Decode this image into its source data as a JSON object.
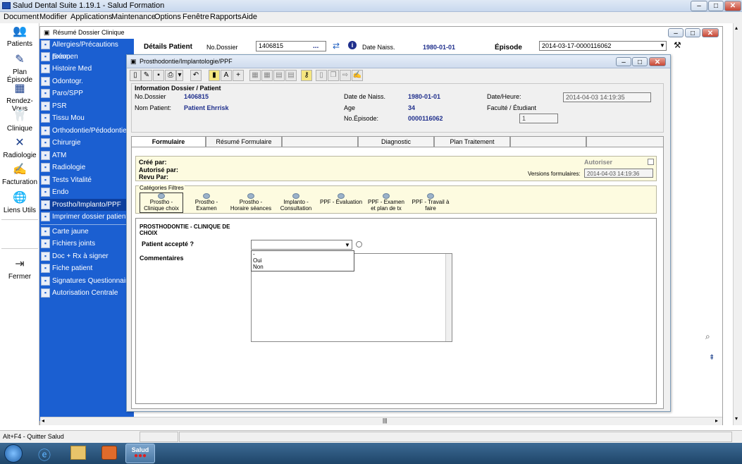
{
  "app": {
    "title": "Salud Dental Suite 1.19.1 - Salud Formation",
    "menu": [
      "Document",
      "Modifier",
      "Applications",
      "Maintenance",
      "Options",
      "Fenêtre",
      "Rapports",
      "Aide"
    ]
  },
  "leftbar": [
    {
      "label": "Patients",
      "icon": "patients-icon"
    },
    {
      "label": "Plan Épisode",
      "icon": "plan-icon"
    },
    {
      "label": "Rendez-Vous",
      "icon": "calendar-icon"
    },
    {
      "label": "Clinique",
      "icon": "tooth-icon"
    },
    {
      "label": "Radiologie",
      "icon": "xray-icon"
    },
    {
      "label": "Facturation",
      "icon": "billing-icon"
    },
    {
      "label": "Liens Utils",
      "icon": "globe-icon"
    },
    {
      "label": "Fermer",
      "icon": "exit-icon"
    }
  ],
  "outer": {
    "title": "Résumé Dossier Clinique"
  },
  "nav": [
    "Allergies/Précautions préop.",
    "Examen",
    "Histoire Med",
    "Odontogr.",
    "Paro/SPP",
    "PSR",
    "Tissu Mou",
    "Orthodontie/Pédodontie",
    "Chirurgie",
    "ATM",
    "Radiologie",
    "Tests Vitalité",
    "Endo",
    "Prostho/Implanto/PPF",
    "Imprimer dossier patient",
    "Carte jaune",
    "Fichiers joints",
    "Doc + Rx à signer",
    "Fiche patient",
    "Signatures Questionnaire",
    "Autorisation Centrale"
  ],
  "details": {
    "label": "Détails Patient",
    "no_dossier_label": "No.Dossier",
    "no_dossier": "1406815",
    "dots": "...",
    "date_naiss_label": "Date Naiss.",
    "date_naiss": "1980-01-01",
    "episode_label": "Épisode",
    "episode": "2014-03-17-0000116062"
  },
  "inner": {
    "title": "Prosthodontie/Implantologie/PPF"
  },
  "info": {
    "heading": "Information Dossier / Patient",
    "no_dossier_label": "No.Dossier",
    "no_dossier": "1406815",
    "nom_label": "Nom Patient:",
    "nom": "Patient Ehrrisk",
    "date_naiss_label": "Date de Naiss.",
    "date_naiss": "1980-01-01",
    "age_label": "Age",
    "age": "34",
    "episode_label": "No.Épisode:",
    "episode": "0000116062",
    "datetime_label": "Date/Heure:",
    "datetime": "2014-04-03 14:19:35",
    "faculte_label": "Faculté / Étudiant",
    "faculte_value": "1"
  },
  "tabs": [
    "Formulaire",
    "Résumé Formulaire",
    "",
    "Diagnostic",
    "Plan Traitement",
    "",
    ""
  ],
  "yellow": {
    "cree": "Créé par:",
    "autorise": "Autorisé par:",
    "revu": "Revu Par:",
    "autoriser": "Autoriser",
    "versions_label": "Versions formulaires:",
    "versions_value": "2014-04-03 14:19:36"
  },
  "categories": {
    "label": "Catégories Filtres",
    "items": [
      {
        "l1": "Prostho -",
        "l2": "Clinique choix"
      },
      {
        "l1": "Prostho -",
        "l2": "Examen"
      },
      {
        "l1": "Prostho -",
        "l2": "Horaire séances"
      },
      {
        "l1": "Implanto -",
        "l2": "Consultation"
      },
      {
        "l1": "PPF - Évaluation",
        "l2": ""
      },
      {
        "l1": "PPF - Examen",
        "l2": "et plan de tx"
      },
      {
        "l1": "PPF - Travail à",
        "l2": "faire"
      }
    ]
  },
  "form": {
    "heading1": "PROSTHODONTIE - CLINIQUE DE",
    "heading2": "CHOIX",
    "q_label": "Patient accepté ?",
    "options": [
      "-",
      "Oui",
      "Non"
    ],
    "commentaires": "Commentaires"
  },
  "status": {
    "left": "Alt+F4 - Quitter Salud"
  },
  "taskbar": {
    "salud": "Salud"
  }
}
